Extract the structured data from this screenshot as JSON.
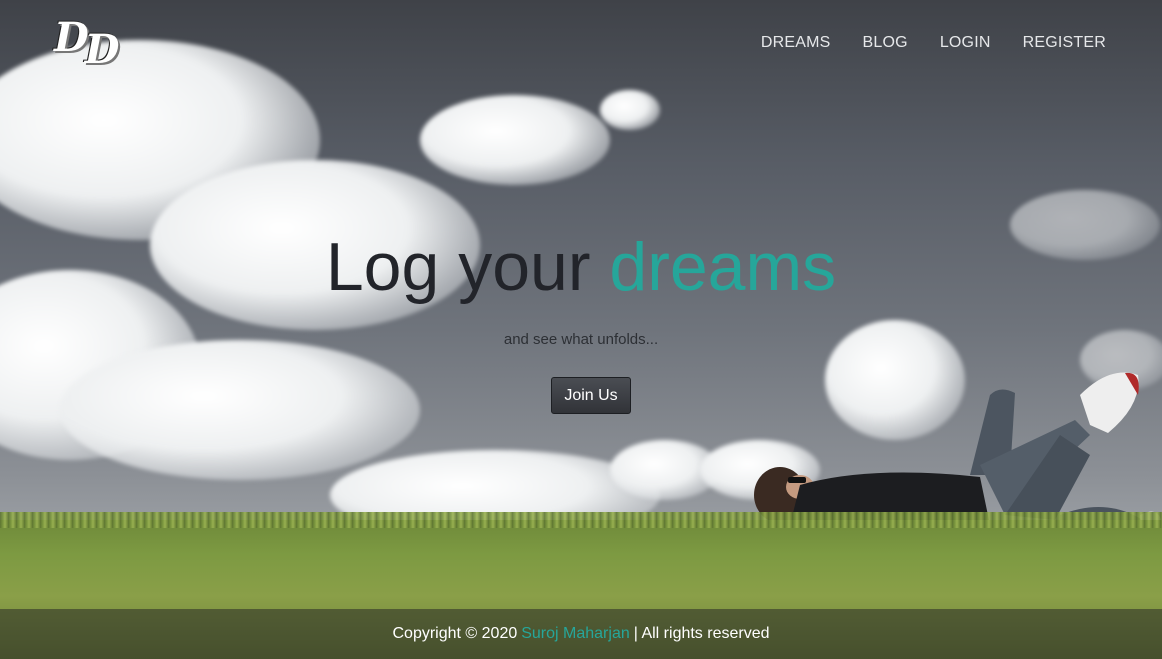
{
  "brand": {
    "logo_text_1": "D",
    "logo_text_2": "D"
  },
  "nav": {
    "items": [
      {
        "label": "DREAMS"
      },
      {
        "label": "BLOG"
      },
      {
        "label": "LOGIN"
      },
      {
        "label": "REGISTER"
      }
    ]
  },
  "hero": {
    "title_main": "Log your",
    "title_accent": "dreams",
    "subtitle": "and see what unfolds...",
    "cta_label": "Join Us"
  },
  "footer": {
    "prefix": "Copyright © 2020",
    "author": "Suroj Maharjan",
    "suffix": "| All rights reserved"
  },
  "colors": {
    "accent": "#26a69a",
    "title": "#22242a",
    "button": "#3b3e43"
  }
}
